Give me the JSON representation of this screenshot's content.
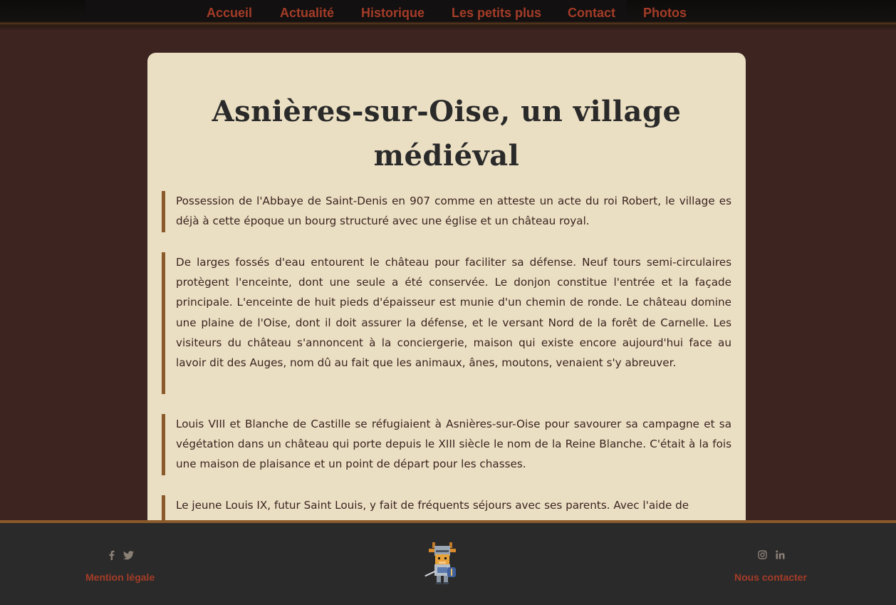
{
  "nav": {
    "items": [
      "Accueil",
      "Actualité",
      "Historique",
      "Les petits plus",
      "Contact",
      "Photos"
    ]
  },
  "article": {
    "title_line1": "Asnières-sur-Oise, un village",
    "title_line2": "médiéval",
    "paragraphs": [
      "Possession de l'Abbaye de Saint-Denis en 907 comme en atteste un acte du roi Robert, le village es déjà à cette époque un bourg structuré avec une église et un château royal.",
      "De larges fossés d'eau entourent le château pour faciliter sa défense. Neuf tours semi-circulaires protègent l'enceinte, dont une seule a été conservée. Le donjon constitue l'entrée et la façade principale. L'enceinte de huit pieds d'épaisseur est munie d'un chemin de ronde. Le château domine une plaine de l'Oise, dont il doit assurer la défense, et le versant Nord de la forêt de Carnelle. Les visiteurs du château s'annoncent à la conciergerie, maison qui existe encore aujourd'hui face au lavoir dit des Auges, nom dû au fait que les animaux, ânes, moutons, venaient s'y abreuver.",
      "Louis VIII et Blanche de Castille se réfugiaient à Asnières-sur-Oise pour savourer sa campagne et sa végétation dans un château qui porte depuis le XIII siècle le nom de la Reine Blanche. C'était à la fois une maison de plaisance et un point de départ pour les chasses.",
      "Le jeune Louis IX, futur Saint Louis, y fait de fréquents séjours avec ses parents. Avec l'aide de"
    ]
  },
  "footer": {
    "left_icons": [
      "facebook-icon",
      "twitter-icon"
    ],
    "left_link": "Mention légale",
    "right_icons": [
      "instagram-icon",
      "linkedin-icon"
    ],
    "right_link": "Nous contacter",
    "mascot": "knight-giraffe-mascot"
  },
  "colors": {
    "background": "#3d2420",
    "card": "#ebdfc3",
    "nav_link": "#a43c28",
    "accent_border": "#8b5a2b",
    "footer": "#2a2a2a"
  }
}
